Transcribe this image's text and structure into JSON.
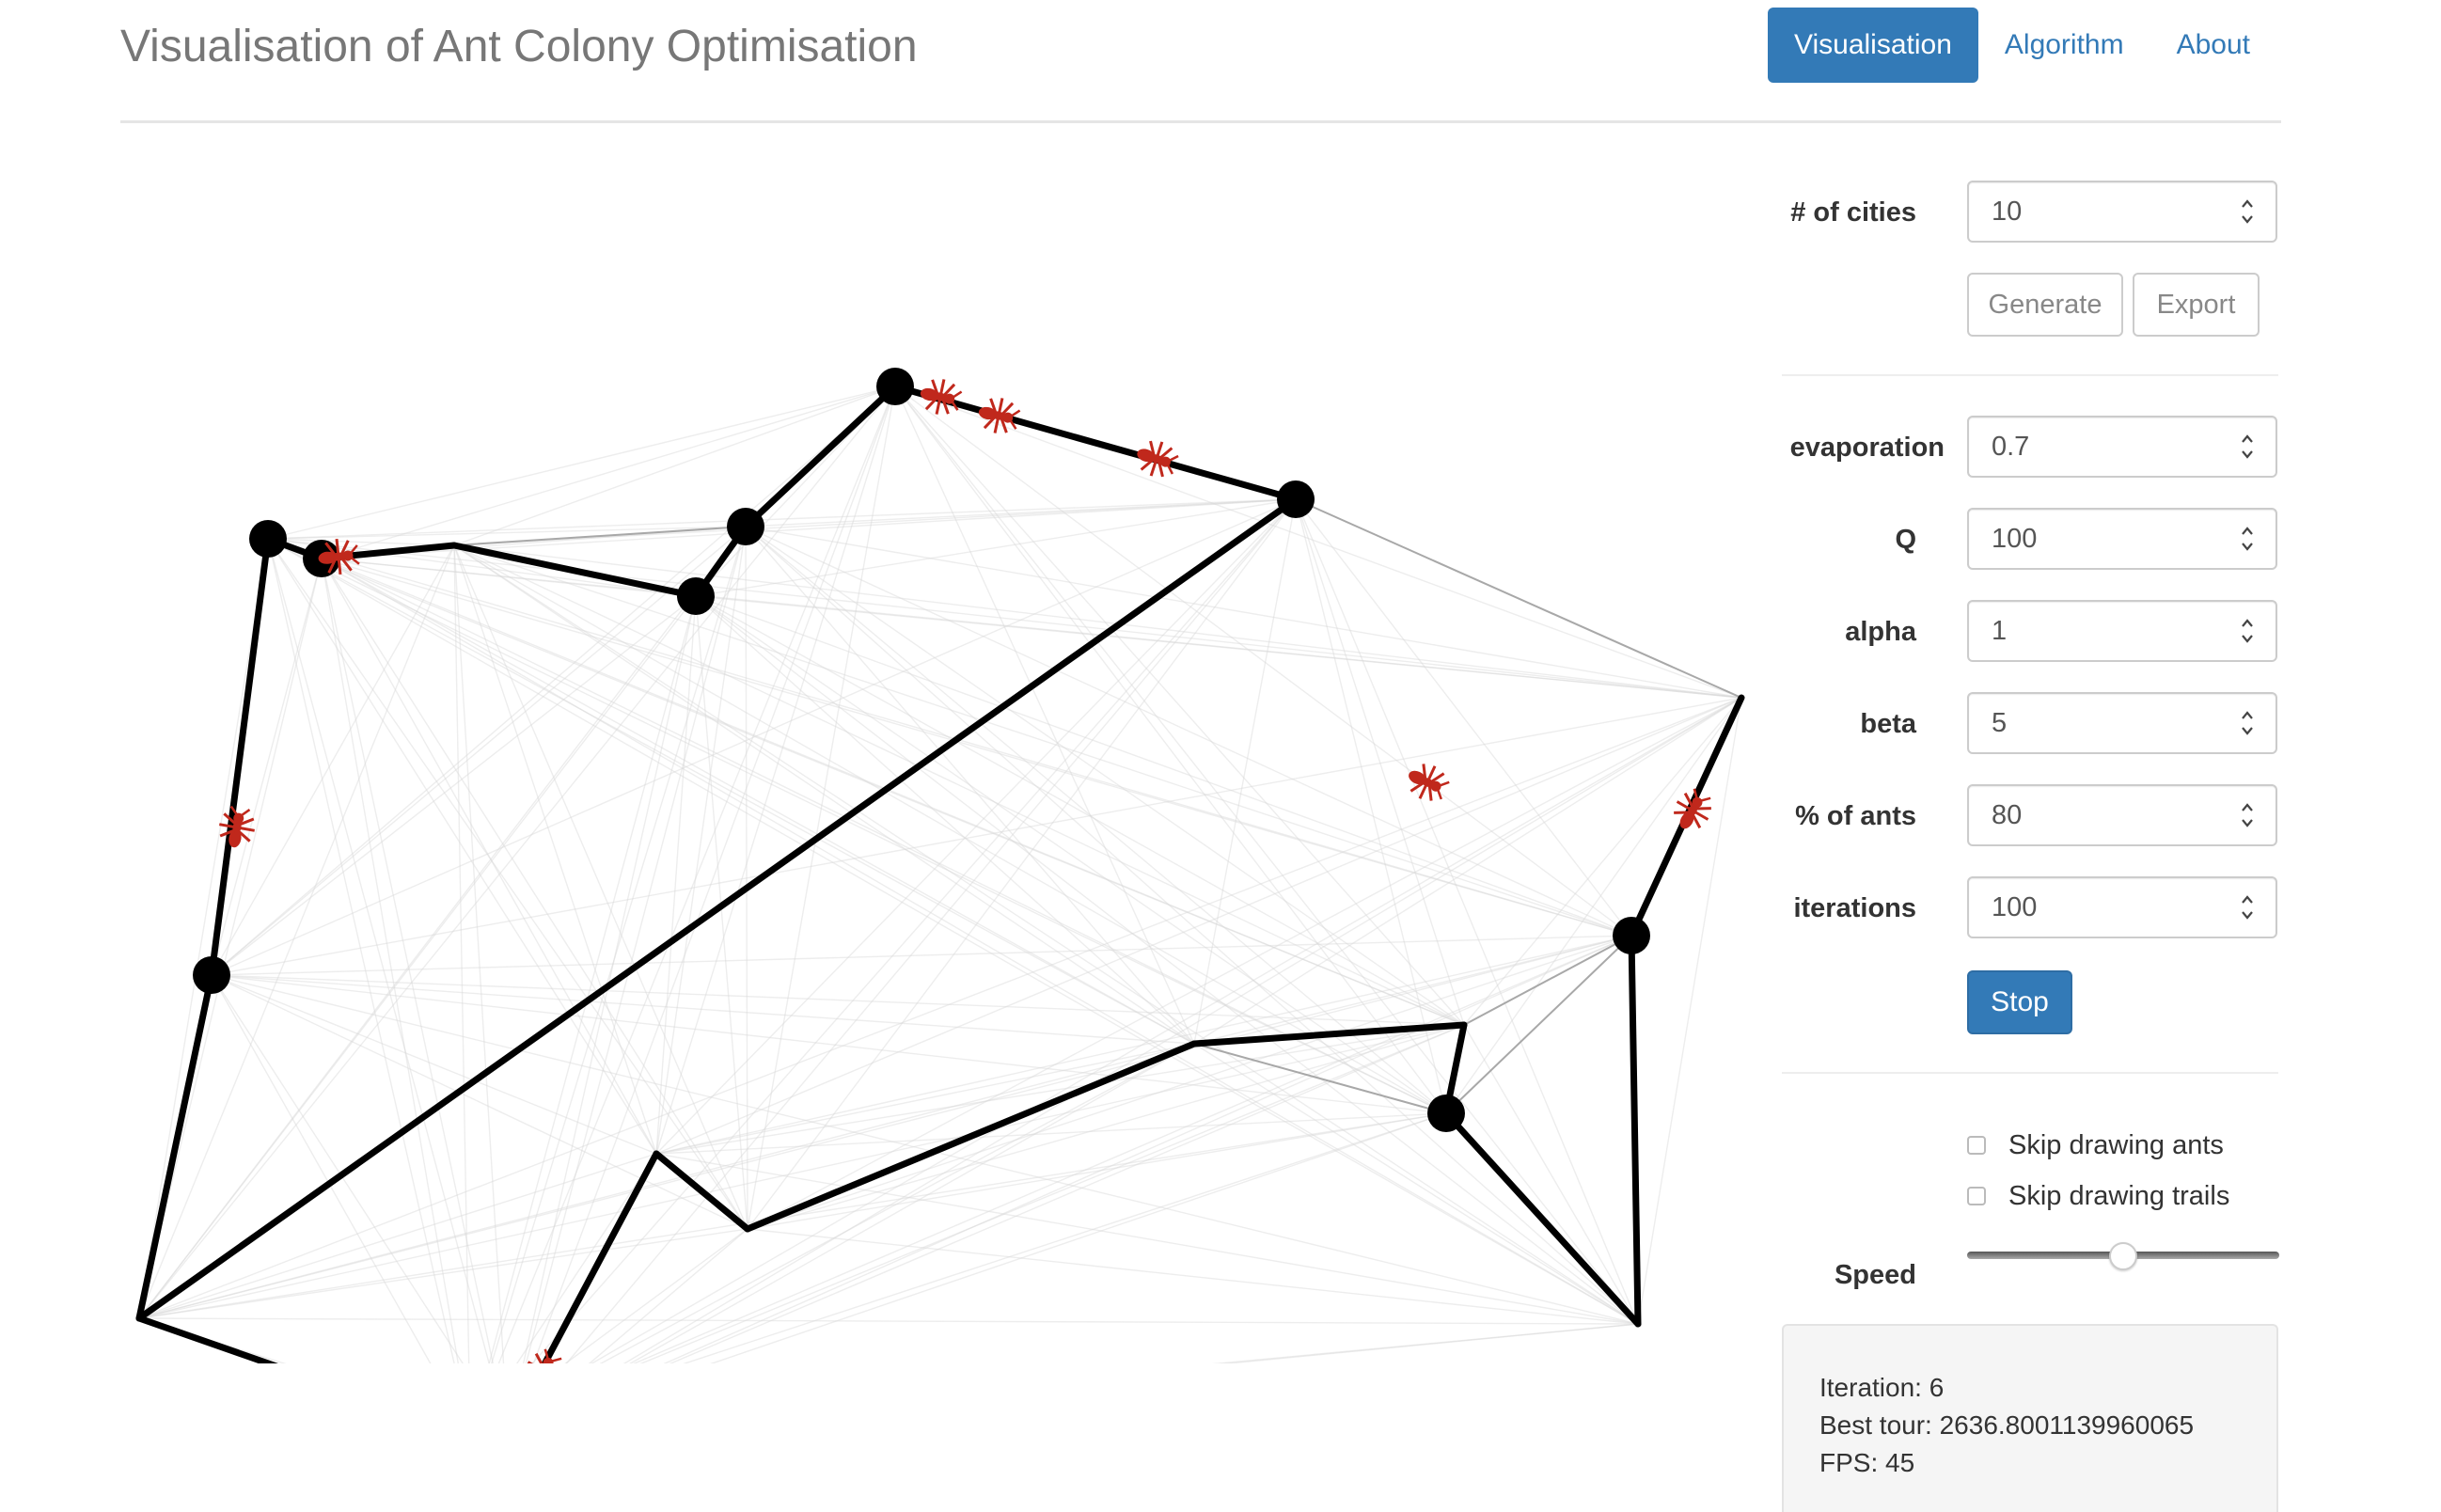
{
  "header": {
    "title": "Visualisation of Ant Colony Optimisation",
    "nav": [
      {
        "label": "Visualisation",
        "active": true
      },
      {
        "label": "Algorithm",
        "active": false
      },
      {
        "label": "About",
        "active": false
      }
    ]
  },
  "controls": {
    "cities": {
      "label": "# of cities",
      "value": "10"
    },
    "generate_label": "Generate",
    "export_label": "Export",
    "evaporation": {
      "label": "evaporation",
      "value": "0.7"
    },
    "q": {
      "label": "Q",
      "value": "100"
    },
    "alpha": {
      "label": "alpha",
      "value": "1"
    },
    "beta": {
      "label": "beta",
      "value": "5"
    },
    "ants": {
      "label": "% of ants",
      "value": "80"
    },
    "iterations": {
      "label": "iterations",
      "value": "100"
    },
    "stop_label": "Stop",
    "skip_ants": {
      "label": "Skip drawing ants",
      "checked": false
    },
    "skip_trails": {
      "label": "Skip drawing trails",
      "checked": false
    },
    "speed": {
      "label": "Speed",
      "fraction": 0.5
    }
  },
  "status": {
    "iteration": "Iteration: 6",
    "best_tour": "Best tour: 2636.8001139960065",
    "fps": "FPS: 45"
  },
  "colors": {
    "accent": "#337ab7",
    "ant": "#c0281c",
    "tour": "#000000",
    "trail": "#d8d8d8"
  },
  "icons": {
    "city": "black-dot",
    "ant": "ant-icon",
    "spinner": "spinner-arrows-icon"
  }
}
